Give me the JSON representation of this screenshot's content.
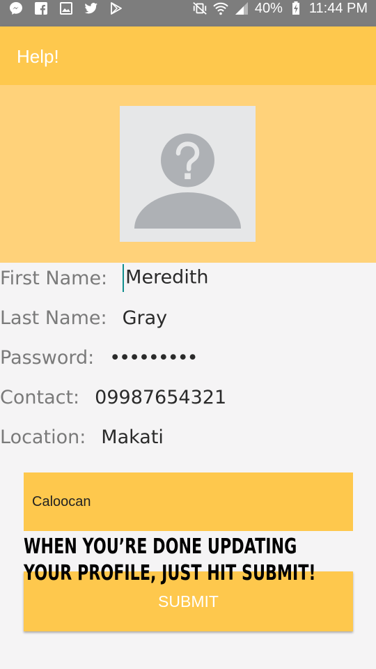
{
  "status_bar": {
    "battery": "40%",
    "time": "11:44 PM"
  },
  "app_bar": {
    "title": "Help!"
  },
  "form": {
    "first_name": {
      "label": "First Name:",
      "value": "Meredith"
    },
    "last_name": {
      "label": "Last Name:",
      "value": "Gray"
    },
    "password": {
      "label": "Password:",
      "value": "•••••••••"
    },
    "contact": {
      "label": "Contact:",
      "value": "09987654321"
    },
    "location": {
      "label": "Location:",
      "value": "Makati"
    }
  },
  "location_box": {
    "text": "Caloocan"
  },
  "hint": {
    "line1": "WHEN YOU’RE DONE UPDATING",
    "line2": "YOUR PROFILE, JUST HIT SUBMIT!"
  },
  "submit": {
    "label": "SUBMIT"
  },
  "colors": {
    "app_bar": "#fec84d",
    "header_band": "#ffd27a",
    "background": "#f5f4f5",
    "status_bar": "#7d7d7d"
  }
}
